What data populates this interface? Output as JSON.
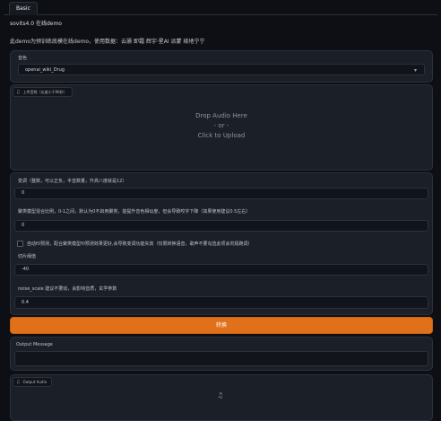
{
  "tabs": [
    "Basic"
  ],
  "title": "sovits4.0 在线demo",
  "subtitle": "此demo为预训练底模在线demo，使用数据：云灏 即霜 辉宇·星AI 派蒙 绫地宁宁",
  "speaker": {
    "label": "音色",
    "value": "openai_wiki_Drug"
  },
  "upload": {
    "label": "上传音频（长度小于90秒）",
    "drop_line1": "Drop Audio Here",
    "drop_line2": "- or -",
    "drop_line3": "Click to Upload"
  },
  "pitch": {
    "label": "变调（整数，可以正负，半音数量，升高八度就是12）",
    "value": "0"
  },
  "cluster": {
    "label": "聚类模型混合比例，0-1之间，默认为0不启用聚类，能提升音色相似度，但会导致咬字下降（如果使用建议0.5左右）",
    "value": "0"
  },
  "auto_f0": {
    "label": "自动f0预测，配合聚类模型f0预测效果更好,会导致变调功能失效（仅限转换语音，歌声不要勾选此项会究极跑调）"
  },
  "slice": {
    "label": "切片阈值",
    "value": "-40"
  },
  "noise": {
    "label": "noise_scale 建议不要动，会影响音质，玄学参数",
    "value": "0.4"
  },
  "run_button": "转换",
  "output_message": {
    "label": "Output Message",
    "value": ""
  },
  "output_audio": {
    "label": "Output Audio"
  },
  "icons": {
    "upload": "music-note-icon",
    "dropdown": "chevron-down-icon",
    "audio_placeholder": "music-note-icon"
  },
  "colors": {
    "accent": "#e0701a",
    "background": "#0d0f14",
    "panel": "#1b1f27"
  }
}
